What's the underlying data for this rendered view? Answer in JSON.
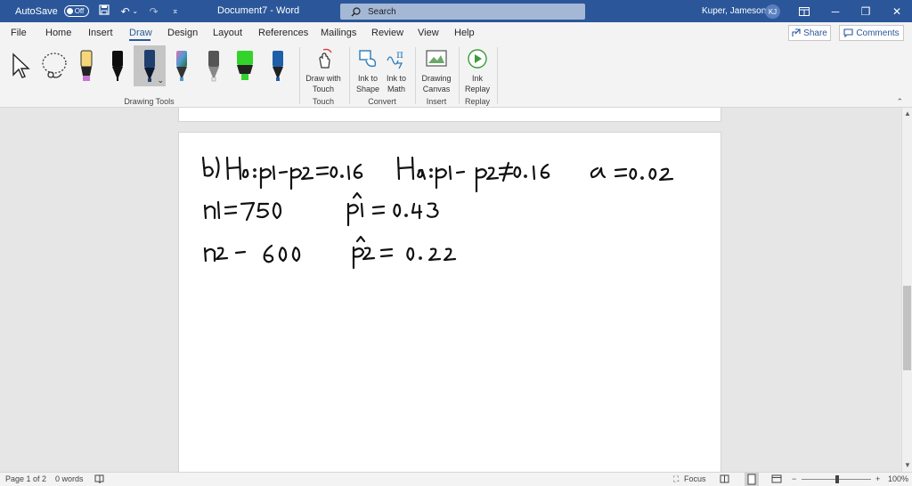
{
  "titlebar": {
    "autosave_label": "AutoSave",
    "autosave_state": "Off",
    "document_title": "Document7  -  Word",
    "search_placeholder": "Search",
    "user_name": "Kuper, Jameson",
    "user_initials": "KJ"
  },
  "ribbon_tabs": [
    "File",
    "Home",
    "Insert",
    "Draw",
    "Design",
    "Layout",
    "References",
    "Mailings",
    "Review",
    "View",
    "Help"
  ],
  "active_tab": "Draw",
  "share_label": "Share",
  "comments_label": "Comments",
  "ribbon": {
    "pen_colors": [
      "#f5d77a",
      "#000000",
      "#1f3f6e",
      "#4b9bd1",
      "#e8e8e8",
      "#34d32c",
      "#1f5fa8"
    ],
    "groups": {
      "drawing_tools": "Drawing Tools",
      "touch": "Touch",
      "convert": "Convert",
      "insert": "Insert",
      "replay": "Replay"
    },
    "buttons": {
      "draw_with_touch": [
        "Draw with",
        "Touch"
      ],
      "ink_to_shape": [
        "Ink to",
        "Shape"
      ],
      "ink_to_math": [
        "Ink to",
        "Math"
      ],
      "drawing_canvas": [
        "Drawing",
        "Canvas"
      ],
      "ink_replay": [
        "Ink",
        "Replay"
      ]
    }
  },
  "document": {
    "ink_lines": [
      "b) H0: p1 − p2 = 0.16    Ha: p1 − p2 ≠ 0.16    α = 0.02",
      "n1 = 750     p̂1 = 0.43",
      "n2 = 600     p̂2 = 0.22"
    ]
  },
  "statusbar": {
    "page": "Page 1 of 2",
    "words": "0 words",
    "focus": "Focus",
    "zoom": "100%"
  }
}
